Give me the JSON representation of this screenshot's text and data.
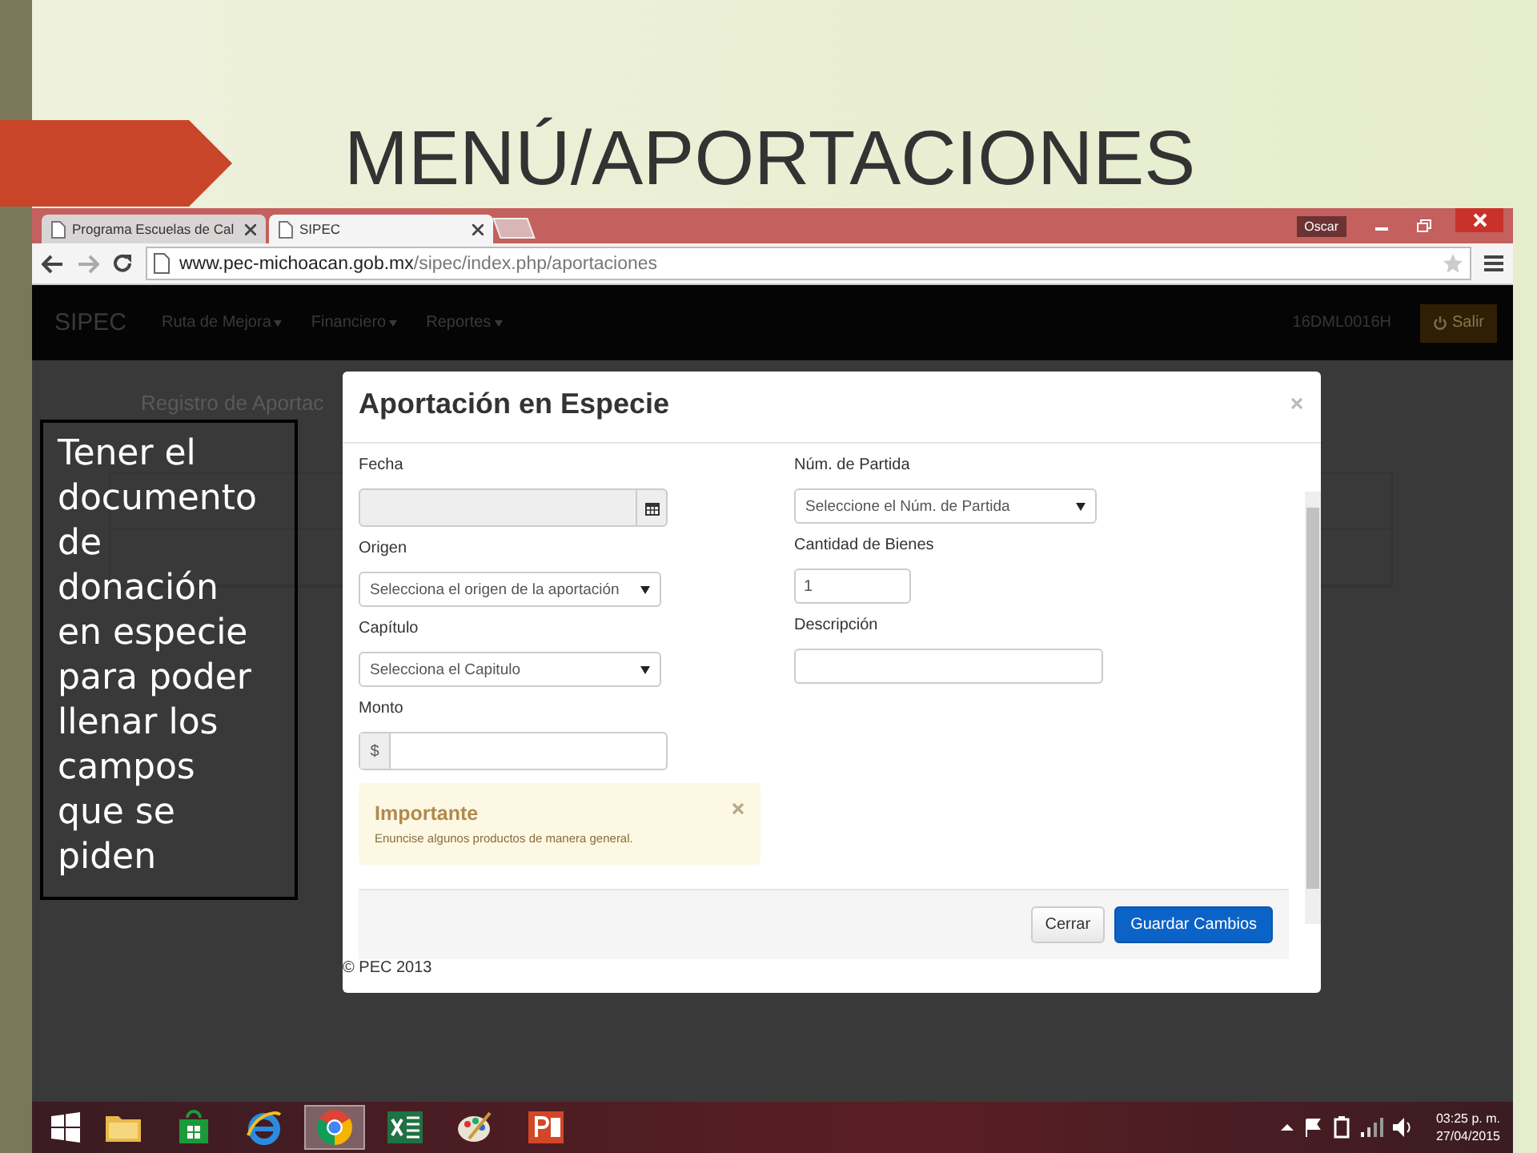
{
  "slide": {
    "title": "MENÚ/APORTACIONES"
  },
  "browser": {
    "tabs": [
      {
        "label": "Programa Escuelas de Cal",
        "selected": false
      },
      {
        "label": "SIPEC",
        "selected": true
      }
    ],
    "user": "Oscar",
    "url_host": "www.pec-michoacan.gob.mx",
    "url_path": "/sipec/index.php/aportaciones"
  },
  "navbar": {
    "brand": "SIPEC",
    "menus": [
      "Ruta de Mejora",
      "Financiero",
      "Reportes"
    ],
    "user_code": "16DML0016H",
    "logout": "Salir"
  },
  "background_page": {
    "heading": "Registro de Aportac"
  },
  "modal": {
    "title": "Aportación en Especie",
    "columns": [
      [
        {
          "label": "Fecha",
          "kind": "date"
        },
        {
          "label": "Origen",
          "kind": "select",
          "value": "Selecciona el origen de la aportación"
        },
        {
          "label": "Capítulo",
          "kind": "select",
          "value": "Selecciona el Capitulo"
        },
        {
          "label": "Monto",
          "kind": "money",
          "prefix": "$"
        }
      ],
      [
        {
          "label": "Núm. de Partida",
          "kind": "select",
          "value": "Seleccione el Núm. de Partida"
        },
        {
          "label": "Cantidad de Bienes",
          "kind": "number",
          "value": "1"
        },
        {
          "label": "Descripción",
          "kind": "text"
        }
      ]
    ],
    "alert": {
      "title": "Importante",
      "text": "Enuncise algunos productos de manera general."
    },
    "buttons": [
      {
        "label": "Cerrar",
        "kind": "default"
      },
      {
        "label": "Guardar Cambios",
        "kind": "primary"
      }
    ],
    "footer": "© PEC 2013"
  },
  "callout": "Tener el documento de donación en especie para poder llenar los campos que se piden",
  "taskbar": {
    "apps": [
      {
        "kind": "folder",
        "selected": false
      },
      {
        "kind": "store",
        "selected": false
      },
      {
        "kind": "ie",
        "selected": false
      },
      {
        "kind": "chrome",
        "selected": true
      },
      {
        "kind": "excel",
        "selected": false
      },
      {
        "kind": "paint",
        "selected": false
      },
      {
        "kind": "powerpoint",
        "selected": false
      }
    ],
    "time": "03:25 p. m.",
    "date": "27/04/2015"
  }
}
